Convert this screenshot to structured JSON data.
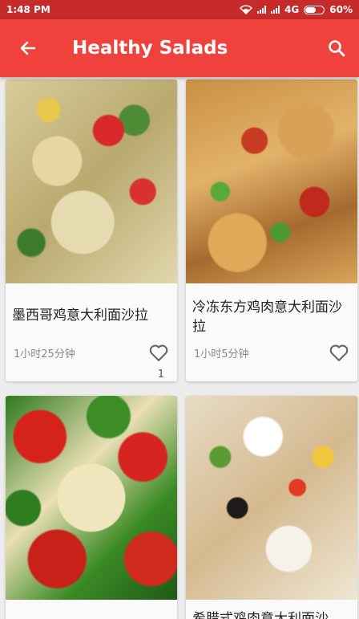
{
  "status_bar": {
    "time": "1:48 PM",
    "network": "4G",
    "battery": "60%",
    "battery_level": 0.6
  },
  "app_bar": {
    "title": "Healthy Salads",
    "back_icon": "arrow-left-icon",
    "search_icon": "search-icon"
  },
  "recipes": [
    {
      "name": "墨西哥鸡意大利面沙拉",
      "duration": "1小时25分钟",
      "likes": "1",
      "icon": "heart-outline-icon"
    },
    {
      "name": "冷冻东方鸡肉意大利面沙拉",
      "duration": "1小时5分钟",
      "likes": "",
      "icon": "heart-outline-icon"
    },
    {
      "name": "",
      "duration": "",
      "likes": "",
      "icon": ""
    },
    {
      "name": "希腊式鸡肉意大利面沙",
      "duration": "",
      "likes": "",
      "icon": ""
    }
  ],
  "colors": {
    "status_bar": "#c62a2a",
    "app_bar": "#f0423c",
    "background": "#ececec",
    "card": "#fafafa",
    "muted_text": "#8a8a8a"
  }
}
